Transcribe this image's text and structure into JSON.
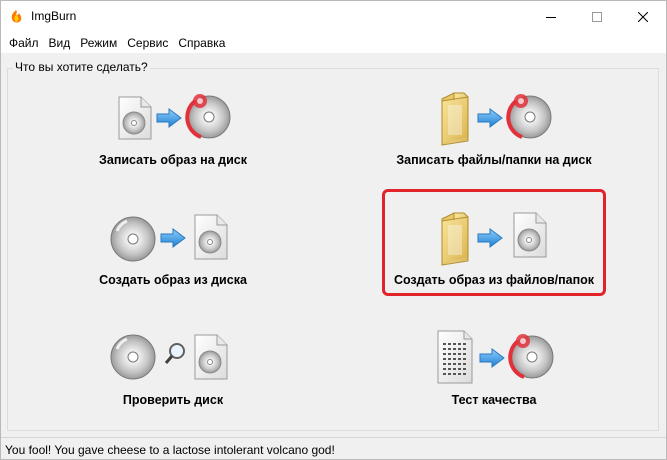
{
  "window": {
    "title": "ImgBurn"
  },
  "menu": [
    "Файл",
    "Вид",
    "Режим",
    "Сервис",
    "Справка"
  ],
  "group": {
    "label": "Что вы хотите сделать?"
  },
  "actions": [
    {
      "label": "Записать образ на диск",
      "icons": [
        "image-file-icon",
        "arrow-right-icon",
        "burn-disc-icon"
      ]
    },
    {
      "label": "Записать файлы/папки на диск",
      "icons": [
        "folder-icon",
        "arrow-right-icon",
        "burn-disc-icon"
      ]
    },
    {
      "label": "Создать образ из диска",
      "icons": [
        "disc-icon",
        "arrow-right-icon",
        "image-file-icon"
      ]
    },
    {
      "label": "Создать образ из файлов/папок",
      "icons": [
        "folder-icon",
        "arrow-right-icon",
        "image-file-icon"
      ]
    },
    {
      "label": "Проверить диск",
      "icons": [
        "disc-icon",
        "magnifier-icon",
        "image-file-icon"
      ]
    },
    {
      "label": "Тест качества",
      "icons": [
        "grid-document-icon",
        "arrow-right-icon",
        "burn-disc-icon"
      ]
    }
  ],
  "status": {
    "text": "You fool! You gave cheese to a lactose intolerant volcano god!"
  },
  "colors": {
    "highlight": "#e0242a",
    "arrow": "#3c9be0",
    "burn": "#e2313b"
  }
}
